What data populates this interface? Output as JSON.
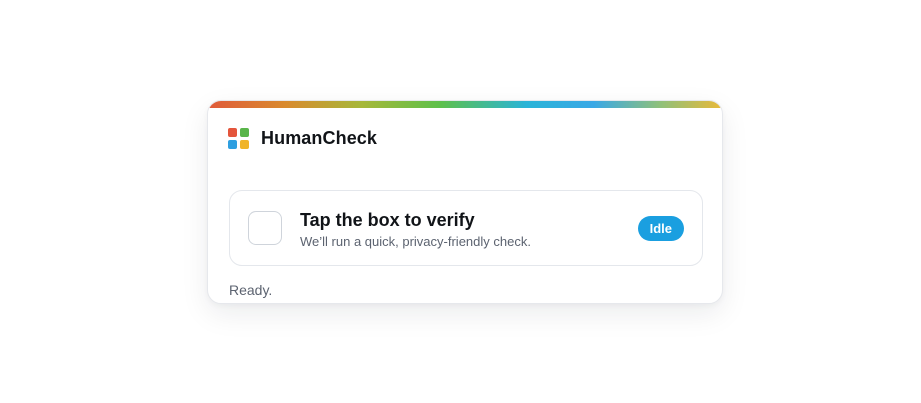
{
  "brand": {
    "name": "HumanCheck",
    "logo_icon": "four-squares-logo-icon",
    "logo_colors": [
      "#e4553c",
      "#59b54a",
      "#2e9fe0",
      "#f0b429"
    ]
  },
  "verify": {
    "title": "Tap the box to verify",
    "subtitle": "We’ll run a quick, privacy-friendly check.",
    "checkbox_checked": false
  },
  "badge": {
    "label": "Idle",
    "color": "#1a9fe0"
  },
  "status": {
    "text": "Ready."
  }
}
